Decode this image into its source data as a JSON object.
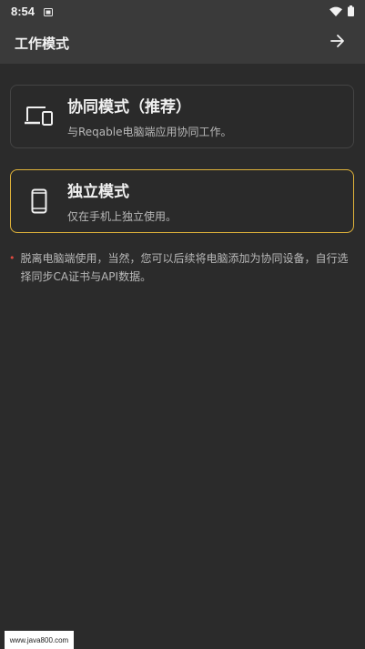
{
  "status_bar": {
    "time": "8:54",
    "icons": [
      "sim-card-icon",
      "wifi-icon",
      "battery-icon"
    ]
  },
  "app_bar": {
    "title": "工作模式",
    "next_icon": "arrow-right-icon"
  },
  "modes": [
    {
      "icon": "devices-icon",
      "title": "协同模式（推荐）",
      "description": "与Reqable电脑端应用协同工作。"
    },
    {
      "icon": "smartphone-icon",
      "title": "独立模式",
      "description": "仅在手机上独立使用。",
      "selected": true
    }
  ],
  "note": {
    "bullet": "•",
    "text": "脱离电脑端使用，当然，您可以后续将电脑添加为协同设备，自行选择同步CA证书与API数据。"
  },
  "watermark": "www.java800.com",
  "colors": {
    "background": "#2b2b2b",
    "bar": "#3a3a3a",
    "selected_border": "#e0b33a",
    "card_border": "#444444",
    "note_bullet": "#e0493f"
  }
}
